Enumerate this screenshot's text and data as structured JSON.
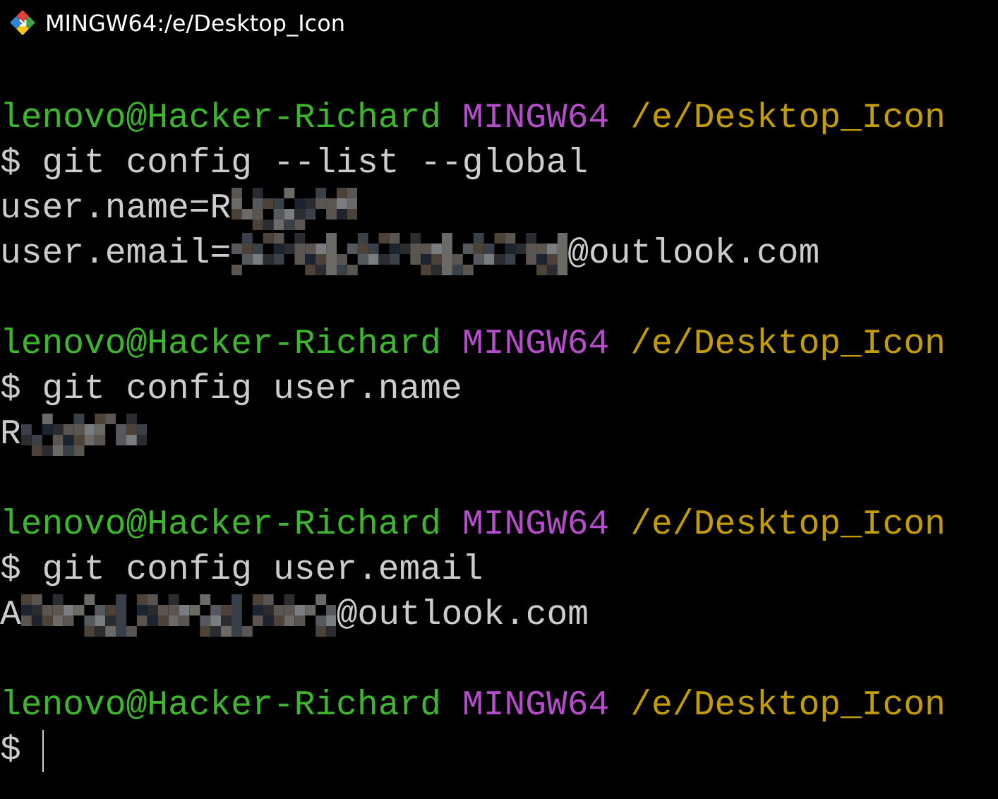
{
  "window": {
    "title": "MINGW64:/e/Desktop_Icon"
  },
  "sessions": [
    {
      "prompt": {
        "user_host": "lenovo@Hacker-Richard",
        "system": "MINGW64",
        "path": "/e/Desktop_Icon"
      },
      "command": "$ git config --list --global",
      "output": [
        [
          {
            "kind": "text",
            "text": "user.name=R"
          },
          {
            "kind": "mosaic_short"
          }
        ],
        [
          {
            "kind": "text",
            "text": "user.email="
          },
          {
            "kind": "mosaic_long"
          },
          {
            "kind": "text",
            "text": "@outlook.com"
          }
        ]
      ]
    },
    {
      "prompt": {
        "user_host": "lenovo@Hacker-Richard",
        "system": "MINGW64",
        "path": "/e/Desktop_Icon"
      },
      "command": "$ git config user.name",
      "output": [
        [
          {
            "kind": "text",
            "text": "R"
          },
          {
            "kind": "mosaic_short"
          }
        ]
      ]
    },
    {
      "prompt": {
        "user_host": "lenovo@Hacker-Richard",
        "system": "MINGW64",
        "path": "/e/Desktop_Icon"
      },
      "command": "$ git config user.email",
      "output": [
        [
          {
            "kind": "text",
            "text": "A"
          },
          {
            "kind": "mosaic_medium"
          },
          {
            "kind": "text",
            "text": "@outlook.com"
          }
        ]
      ]
    },
    {
      "prompt": {
        "user_host": "lenovo@Hacker-Richard",
        "system": "MINGW64",
        "path": "/e/Desktop_Icon"
      },
      "command": "$",
      "cursor": true
    }
  ]
}
